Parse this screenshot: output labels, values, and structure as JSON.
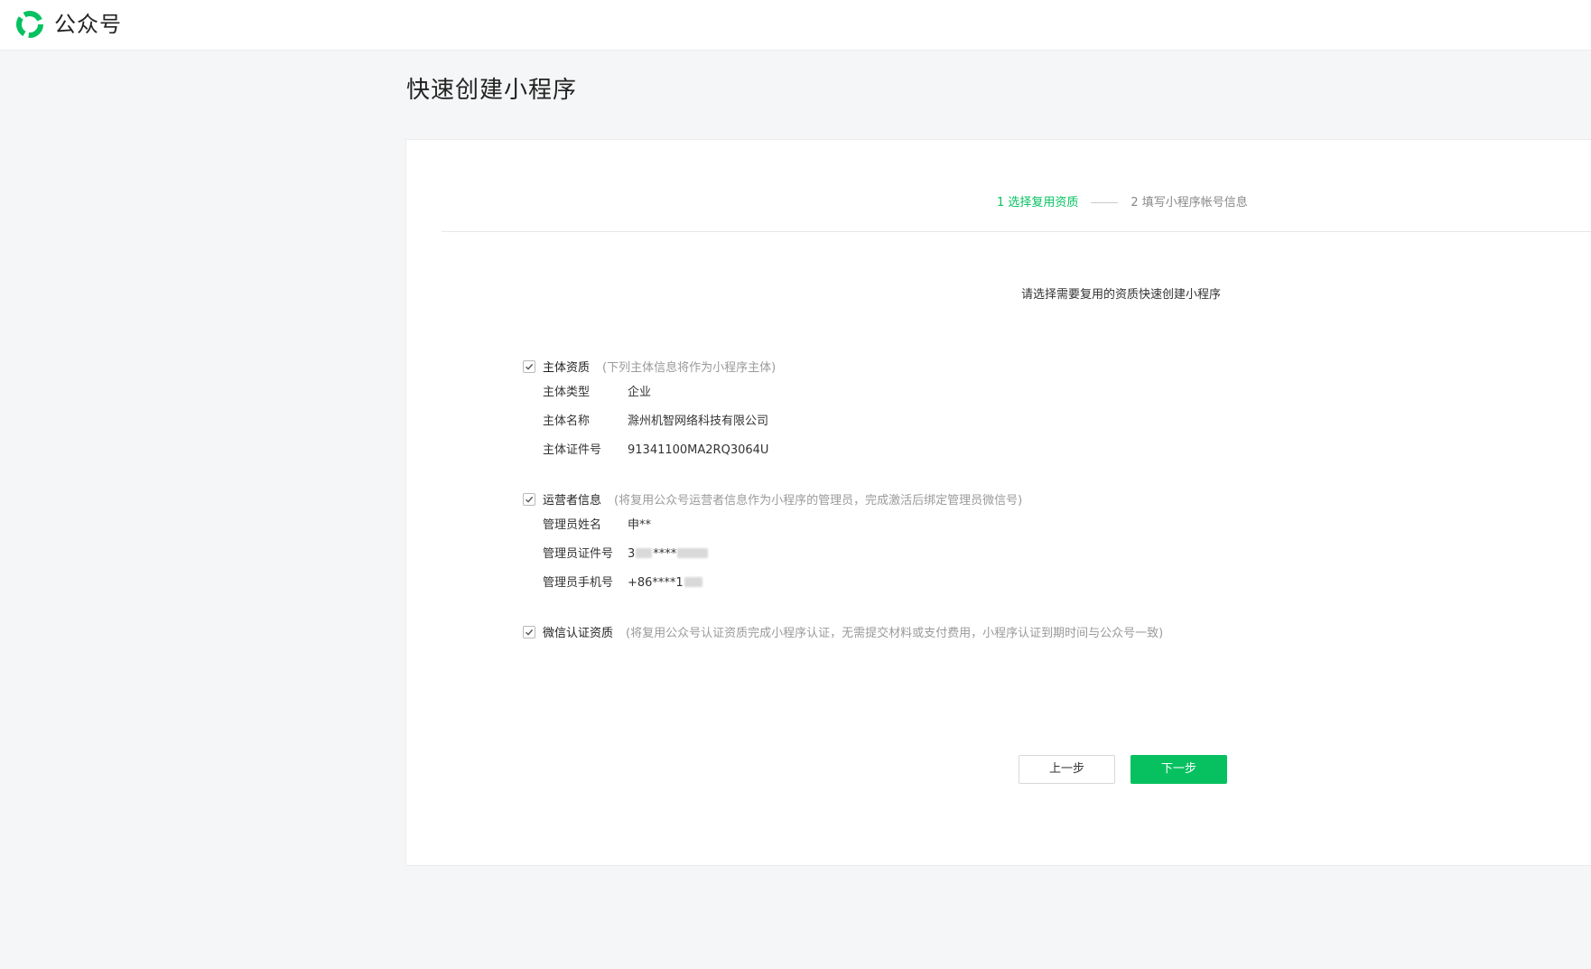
{
  "header": {
    "logo_text": "公众号",
    "brand_color": "#07c160",
    "logo_icon": "wechat-official-account-icon"
  },
  "page": {
    "title": "快速创建小程序"
  },
  "steps": {
    "step1": "1 选择复用资质",
    "step2": "2 填写小程序帐号信息",
    "active": 1
  },
  "instruction": "请选择需要复用的资质快速创建小程序",
  "sections": {
    "entity": {
      "checked": true,
      "title": "主体资质",
      "note": "(下列主体信息将作为小程序主体)",
      "rows": [
        {
          "label": "主体类型",
          "value": "企业"
        },
        {
          "label": "主体名称",
          "value": "滁州机智网络科技有限公司"
        },
        {
          "label": "主体证件号",
          "value": "91341100MA2RQ3064U"
        }
      ]
    },
    "operator": {
      "checked": true,
      "title": "运营者信息",
      "note": "(将复用公众号运营者信息作为小程序的管理员，完成激活后绑定管理员微信号)",
      "rows": [
        {
          "label": "管理员姓名",
          "value": "申**"
        },
        {
          "label": "管理员证件号",
          "value_prefix": "3",
          "value_mid": "****"
        },
        {
          "label": "管理员手机号",
          "value_prefix": "+86****1"
        }
      ]
    },
    "wechat_cert": {
      "checked": true,
      "title": "微信认证资质",
      "note": "(将复用公众号认证资质完成小程序认证，无需提交材料或支付费用，小程序认证到期时间与公众号一致)"
    }
  },
  "buttons": {
    "prev": "上一步",
    "next": "下一步"
  }
}
